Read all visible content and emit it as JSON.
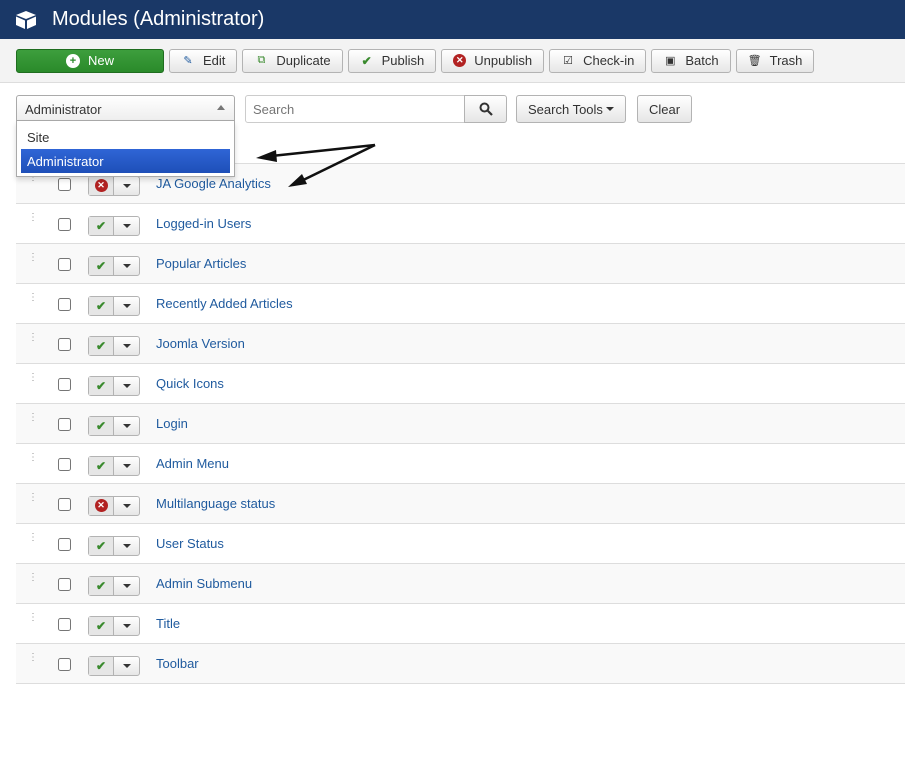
{
  "header": {
    "title": "Modules (Administrator)"
  },
  "toolbar": {
    "new": "New",
    "edit": "Edit",
    "duplicate": "Duplicate",
    "publish": "Publish",
    "unpublish": "Unpublish",
    "checkin": "Check-in",
    "batch": "Batch",
    "trash": "Trash"
  },
  "filters": {
    "client_selected": "Administrator",
    "client_options": [
      "Site",
      "Administrator"
    ],
    "search_placeholder": "Search",
    "search_tools": "Search Tools",
    "clear": "Clear"
  },
  "modules": [
    {
      "title": "JA Google Analytics",
      "published": false
    },
    {
      "title": "Logged-in Users",
      "published": true
    },
    {
      "title": "Popular Articles",
      "published": true
    },
    {
      "title": "Recently Added Articles",
      "published": true
    },
    {
      "title": "Joomla Version",
      "published": true
    },
    {
      "title": "Quick Icons",
      "published": true
    },
    {
      "title": "Login",
      "published": true
    },
    {
      "title": "Admin Menu",
      "published": true
    },
    {
      "title": "Multilanguage status",
      "published": false
    },
    {
      "title": "User Status",
      "published": true
    },
    {
      "title": "Admin Submenu",
      "published": true
    },
    {
      "title": "Title",
      "published": true
    },
    {
      "title": "Toolbar",
      "published": true
    }
  ]
}
